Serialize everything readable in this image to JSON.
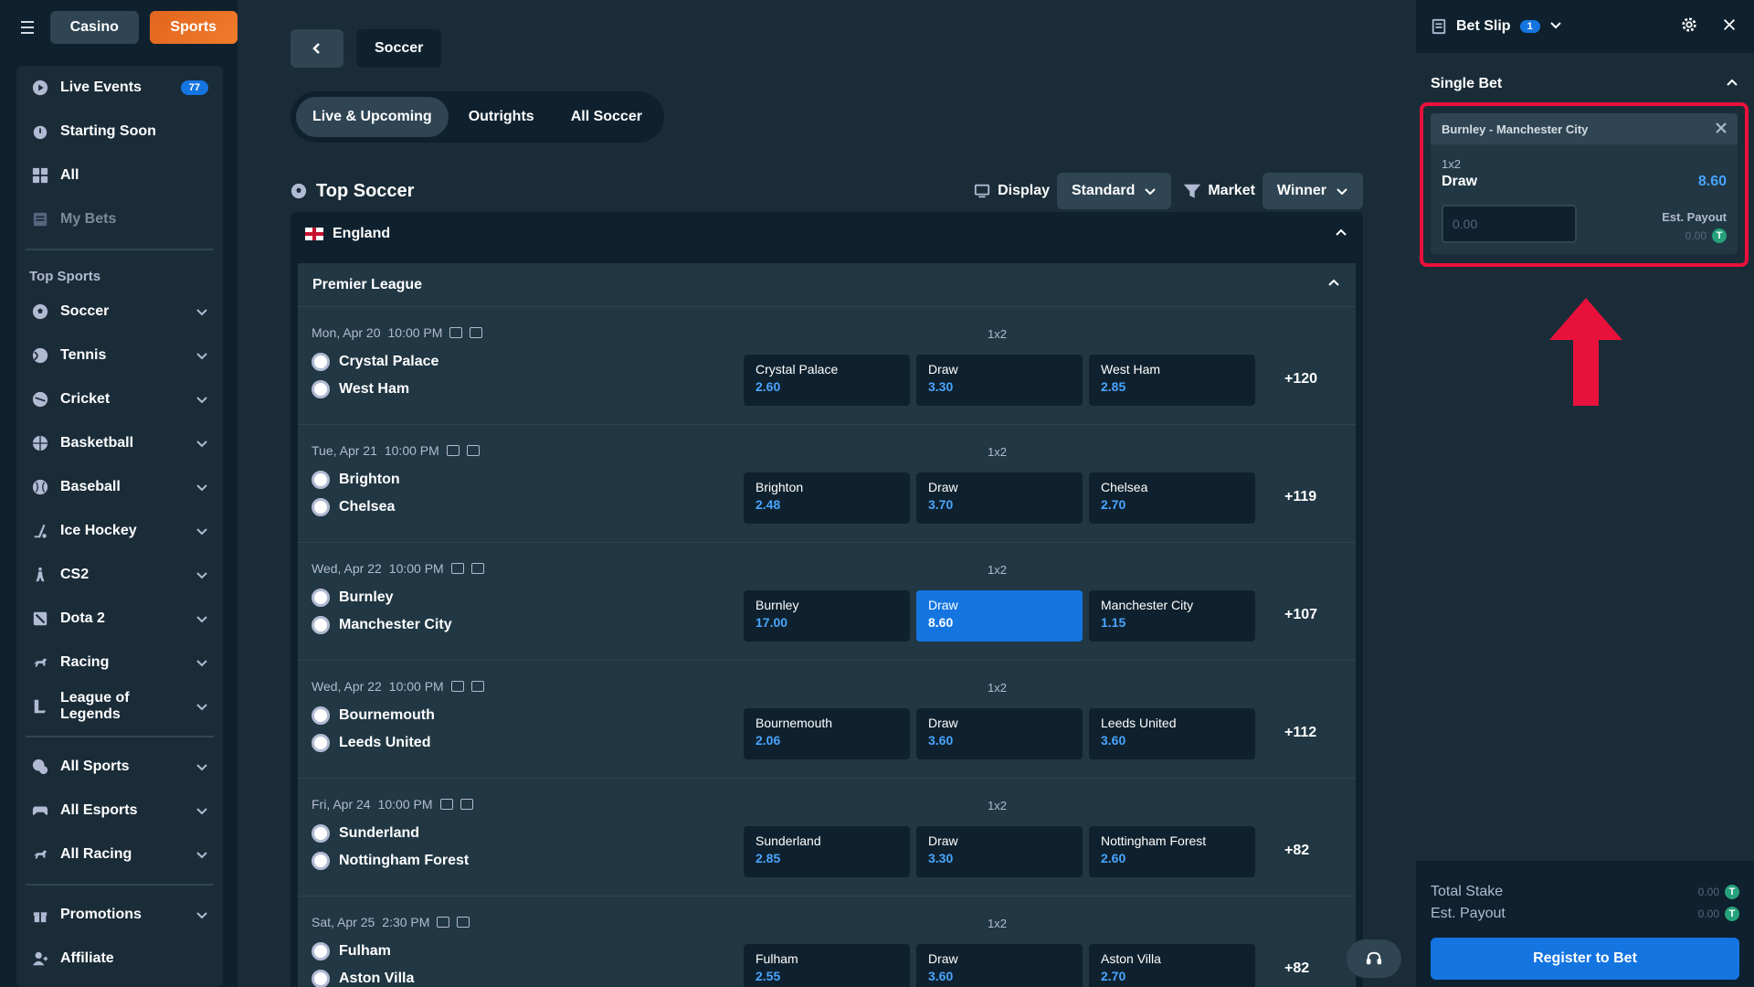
{
  "header": {
    "casino_label": "Casino",
    "sports_label": "Sports"
  },
  "sidebar": {
    "primary": [
      {
        "label": "Live Events",
        "icon": "live-icon",
        "badge": "77"
      },
      {
        "label": "Starting Soon",
        "icon": "clock-icon"
      },
      {
        "label": "All",
        "icon": "grid-icon"
      },
      {
        "label": "My Bets",
        "icon": "bets-icon"
      }
    ],
    "top_sports_heading": "Top Sports",
    "sports": [
      {
        "label": "Soccer",
        "icon": "soccer-icon"
      },
      {
        "label": "Tennis",
        "icon": "tennis-icon"
      },
      {
        "label": "Cricket",
        "icon": "cricket-icon"
      },
      {
        "label": "Basketball",
        "icon": "basketball-icon"
      },
      {
        "label": "Baseball",
        "icon": "baseball-icon"
      },
      {
        "label": "Ice Hockey",
        "icon": "hockey-icon"
      },
      {
        "label": "CS2",
        "icon": "cs2-icon"
      },
      {
        "label": "Dota 2",
        "icon": "dota-icon"
      },
      {
        "label": "Racing",
        "icon": "racing-icon"
      },
      {
        "label": "League of Legends",
        "icon": "lol-icon"
      }
    ],
    "all": [
      {
        "label": "All Sports",
        "icon": "all-sports-icon"
      },
      {
        "label": "All Esports",
        "icon": "controller-icon"
      },
      {
        "label": "All Racing",
        "icon": "horse-icon"
      }
    ],
    "extra": [
      {
        "label": "Promotions",
        "icon": "gift-icon"
      },
      {
        "label": "Affiliate",
        "icon": "affiliate-icon"
      }
    ]
  },
  "main": {
    "breadcrumb": "Soccer",
    "tabs": [
      "Live & Upcoming",
      "Outrights",
      "All Soccer"
    ],
    "section_title": "Top Soccer",
    "display_label": "Display",
    "display_value": "Standard",
    "market_label": "Market",
    "market_value": "Winner",
    "country": "England",
    "league": "Premier League",
    "matches": [
      {
        "date": "Mon, Apr 20",
        "time": "10:00 PM",
        "market": "1x2",
        "home": "Crystal Palace",
        "away": "West Ham",
        "odds": [
          {
            "name": "Crystal Palace",
            "value": "2.60"
          },
          {
            "name": "Draw",
            "value": "3.30"
          },
          {
            "name": "West Ham",
            "value": "2.85"
          }
        ],
        "more": "+120"
      },
      {
        "date": "Tue, Apr 21",
        "time": "10:00 PM",
        "market": "1x2",
        "home": "Brighton",
        "away": "Chelsea",
        "odds": [
          {
            "name": "Brighton",
            "value": "2.48"
          },
          {
            "name": "Draw",
            "value": "3.70"
          },
          {
            "name": "Chelsea",
            "value": "2.70"
          }
        ],
        "more": "+119"
      },
      {
        "date": "Wed, Apr 22",
        "time": "10:00 PM",
        "market": "1x2",
        "home": "Burnley",
        "away": "Manchester City",
        "odds": [
          {
            "name": "Burnley",
            "value": "17.00"
          },
          {
            "name": "Draw",
            "value": "8.60"
          },
          {
            "name": "Manchester City",
            "value": "1.15"
          }
        ],
        "more": "+107"
      },
      {
        "date": "Wed, Apr 22",
        "time": "10:00 PM",
        "market": "1x2",
        "home": "Bournemouth",
        "away": "Leeds United",
        "odds": [
          {
            "name": "Bournemouth",
            "value": "2.06"
          },
          {
            "name": "Draw",
            "value": "3.60"
          },
          {
            "name": "Leeds United",
            "value": "3.60"
          }
        ],
        "more": "+112"
      },
      {
        "date": "Fri, Apr 24",
        "time": "10:00 PM",
        "market": "1x2",
        "home": "Sunderland",
        "away": "Nottingham Forest",
        "odds": [
          {
            "name": "Sunderland",
            "value": "2.85"
          },
          {
            "name": "Draw",
            "value": "3.30"
          },
          {
            "name": "Nottingham Forest",
            "value": "2.60"
          }
        ],
        "more": "+82"
      },
      {
        "date": "Sat, Apr 25",
        "time": "2:30 PM",
        "market": "1x2",
        "home": "Fulham",
        "away": "Aston Villa",
        "odds": [
          {
            "name": "Fulham",
            "value": "2.55"
          },
          {
            "name": "Draw",
            "value": "3.60"
          },
          {
            "name": "Aston Villa",
            "value": "2.70"
          }
        ],
        "more": "+82"
      }
    ]
  },
  "betslip": {
    "title": "Bet Slip",
    "count": "1",
    "section": "Single Bet",
    "event": "Burnley - Manchester City",
    "market": "1x2",
    "selection": "Draw",
    "odds": "8.60",
    "stake_placeholder": "0.00",
    "est_payout_label": "Est. Payout",
    "est_payout_value": "0.00",
    "total_stake_label": "Total Stake",
    "total_stake_value": "0.00",
    "footer_payout_label": "Est. Payout",
    "footer_payout_value": "0.00",
    "register_label": "Register to Bet"
  },
  "colors": {
    "accent": "#1475e1",
    "sports": "#f07b2b",
    "highlight": "#e8113c",
    "odds": "#49a4ff"
  }
}
